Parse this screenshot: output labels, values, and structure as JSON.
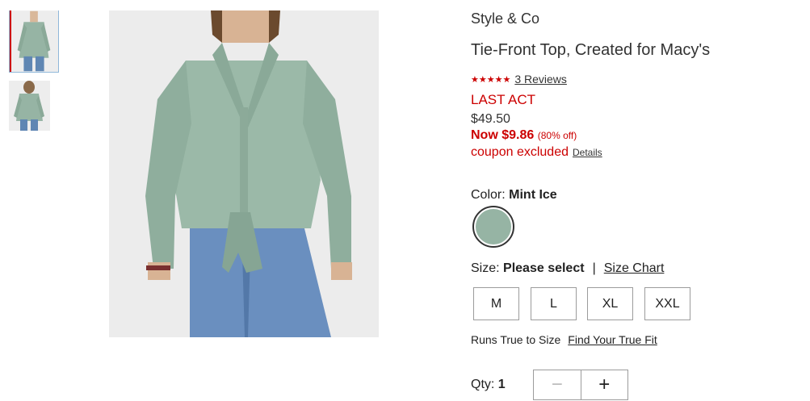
{
  "product": {
    "brand": "Style & Co",
    "title": "Tie-Front Top, Created for Macy's",
    "stars": "★★★★★",
    "reviews_label": "3 Reviews",
    "badge": "LAST ACT",
    "original_price": "$49.50",
    "now_price": "Now $9.86",
    "discount": "(80% off)",
    "coupon_text": "coupon excluded",
    "details_label": "Details"
  },
  "color": {
    "label": "Color:",
    "selected": "Mint Ice",
    "swatch_hex": "#96b4a4"
  },
  "size": {
    "label": "Size:",
    "selected": "Please select",
    "separator": "|",
    "chart_label": "Size Chart",
    "options": [
      "M",
      "L",
      "XL",
      "XXL"
    ]
  },
  "fit": {
    "text": "Runs True to Size",
    "link": "Find Your True Fit"
  },
  "quantity": {
    "label": "Qty:",
    "value": "1",
    "minus_symbol": "−",
    "plus_symbol": "+"
  },
  "colors": {
    "accent_red": "#cc0000",
    "thumb_border": "#8fb7d9"
  }
}
